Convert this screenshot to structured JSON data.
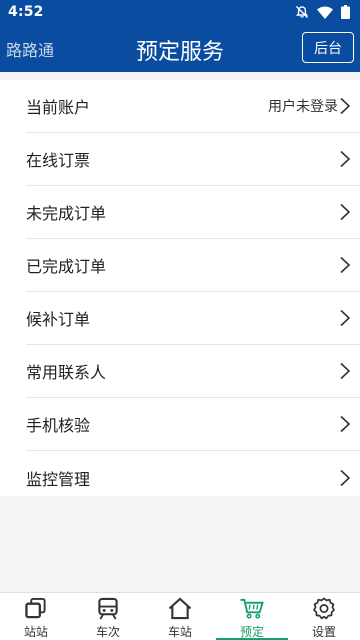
{
  "status_bar": {
    "time": "4:52"
  },
  "header": {
    "brand": "路路通",
    "title": "预定服务",
    "action_label": "后台"
  },
  "menu": {
    "items": [
      {
        "label": "当前账户",
        "value": "用户未登录"
      },
      {
        "label": "在线订票"
      },
      {
        "label": "未完成订单"
      },
      {
        "label": "已完成订单"
      },
      {
        "label": "候补订单"
      },
      {
        "label": "常用联系人"
      },
      {
        "label": "手机核验"
      },
      {
        "label": "监控管理"
      }
    ]
  },
  "tabbar": {
    "active_color": "#18a06a",
    "items": [
      {
        "label": "站站",
        "icon": "stacked-squares-icon"
      },
      {
        "label": "车次",
        "icon": "train-icon"
      },
      {
        "label": "车站",
        "icon": "house-icon"
      },
      {
        "label": "预定",
        "icon": "shopping-cart-icon",
        "active": true
      },
      {
        "label": "设置",
        "icon": "gear-icon"
      }
    ]
  }
}
